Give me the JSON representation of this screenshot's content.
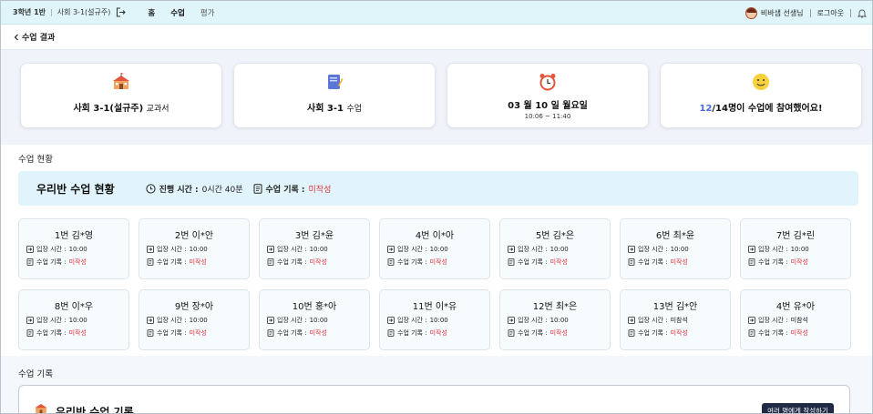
{
  "header": {
    "class_label": "3학년 1반",
    "subject_label": "사회 3-1(설규주)",
    "nav": [
      {
        "label": "홈"
      },
      {
        "label": "수업"
      },
      {
        "label": "평가"
      }
    ],
    "user_name": "비바샘 선생님",
    "logout_label": "로그아웃"
  },
  "back": {
    "label": "수업 결과"
  },
  "info_cards": {
    "textbook": {
      "main": "사회 3-1(설규주)",
      "suffix": "교과서"
    },
    "lesson": {
      "main": "사회 3-1",
      "suffix": "수업"
    },
    "date": {
      "main": "03 월 10 일 월요일",
      "sub": "10:06 ~ 11:40"
    },
    "participation": {
      "joined": "12",
      "total": "/14",
      "text": "명이 수업에 참여했어요!"
    }
  },
  "status_section": {
    "title": "수업 현황",
    "banner_title": "우리반 수업 현황",
    "time_label": "진행 시간 :",
    "time_value": "0시간 40분",
    "record_label": "수업 기록 :",
    "record_value": "미작성"
  },
  "students": [
    {
      "name": "1번 김*영",
      "entry_label": "입장 시간 :",
      "entry": "10:00",
      "record_label": "수업 기록 :",
      "record": "미작성"
    },
    {
      "name": "2번 이*안",
      "entry_label": "입장 시간 :",
      "entry": "10:00",
      "record_label": "수업 기록 :",
      "record": "미작성"
    },
    {
      "name": "3번 김*윤",
      "entry_label": "입장 시간 :",
      "entry": "10:00",
      "record_label": "수업 기록 :",
      "record": "미작성"
    },
    {
      "name": "4번 이*아",
      "entry_label": "입장 시간 :",
      "entry": "10:00",
      "record_label": "수업 기록 :",
      "record": "미작성"
    },
    {
      "name": "5번 김*은",
      "entry_label": "입장 시간 :",
      "entry": "10:00",
      "record_label": "수업 기록 :",
      "record": "미작성"
    },
    {
      "name": "6번 최*윤",
      "entry_label": "입장 시간 :",
      "entry": "10:00",
      "record_label": "수업 기록 :",
      "record": "미작성"
    },
    {
      "name": "7번 김*린",
      "entry_label": "입장 시간 :",
      "entry": "10:00",
      "record_label": "수업 기록 :",
      "record": "미작성"
    },
    {
      "name": "8번 이*우",
      "entry_label": "입장 시간 :",
      "entry": "10:00",
      "record_label": "수업 기록 :",
      "record": "미작성"
    },
    {
      "name": "9번 장*아",
      "entry_label": "입장 시간 :",
      "entry": "10:00",
      "record_label": "수업 기록 :",
      "record": "미작성"
    },
    {
      "name": "10번 홍*아",
      "entry_label": "입장 시간 :",
      "entry": "10:00",
      "record_label": "수업 기록 :",
      "record": "미작성"
    },
    {
      "name": "11번 이*유",
      "entry_label": "입장 시간 :",
      "entry": "10:00",
      "record_label": "수업 기록 :",
      "record": "미작성"
    },
    {
      "name": "12번 최*은",
      "entry_label": "입장 시간 :",
      "entry": "10:00",
      "record_label": "수업 기록 :",
      "record": "미작성"
    },
    {
      "name": "13번 김*안",
      "entry_label": "입장 시간 :",
      "entry": "미참석",
      "record_label": "수업 기록 :",
      "record": "미작성"
    },
    {
      "name": "4번 유*아",
      "entry_label": "입장 시간 :",
      "entry": "미참석",
      "record_label": "수업 기록 :",
      "record": "미작성"
    }
  ],
  "record_section": {
    "title": "수업 기록",
    "box_title": "우리반 수업 기록",
    "button_label": "여러 명에게 작성하기"
  },
  "colors": {
    "accent_red": "#e0323a",
    "accent_blue": "#4a6bd8",
    "topbar_bg": "#dff5f9",
    "banner_bg": "#e2f4fb",
    "button_bg": "#1f2a45"
  },
  "icons": [
    "exit-icon",
    "bell-icon",
    "school-icon",
    "book-icon",
    "alarm-clock-icon",
    "smile-icon",
    "clock-icon",
    "document-icon",
    "entry-icon"
  ]
}
